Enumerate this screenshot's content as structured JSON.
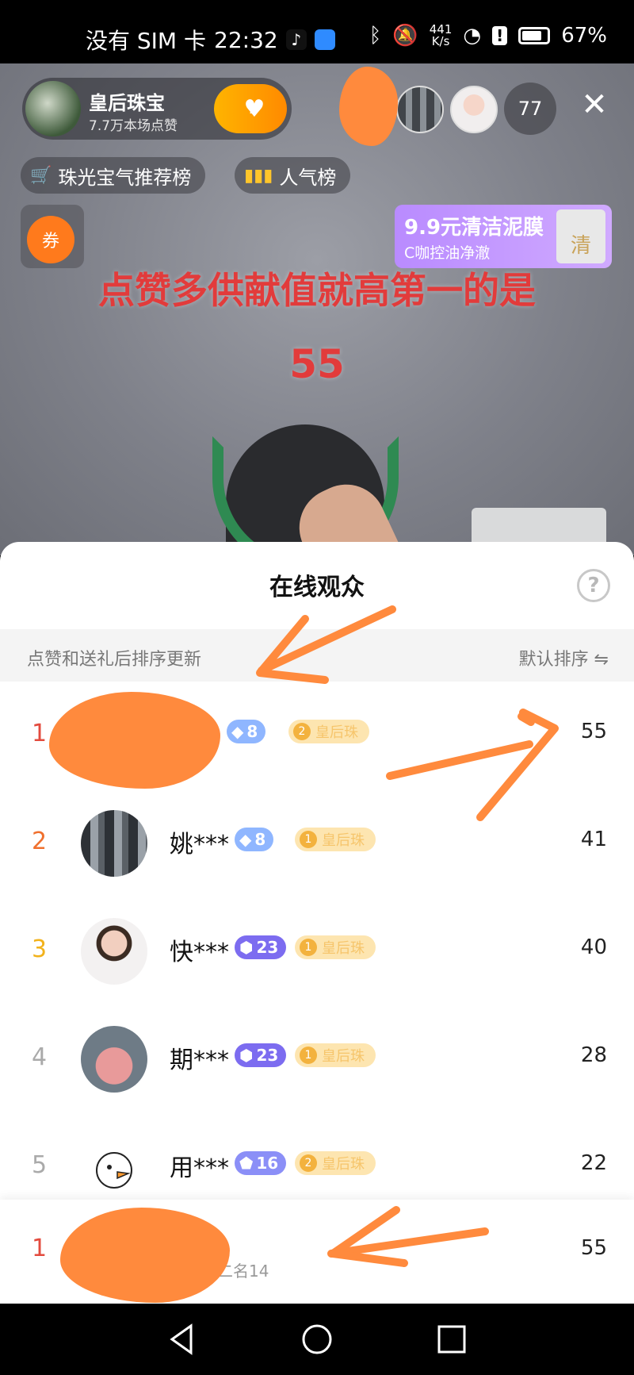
{
  "status_bar": {
    "carrier": "没有 SIM 卡",
    "time": "22:32",
    "net_speed_value": "441",
    "net_speed_unit": "K/s",
    "battery": "67%"
  },
  "live": {
    "anchor_name": "皇后珠宝",
    "anchor_likes": "7.7万本场点赞",
    "follow_level": "2",
    "viewer_count": "77",
    "rank_chip_1": "珠光宝气推荐榜",
    "rank_chip_2": "人气榜",
    "coupon_label": "券",
    "promo_title": "9.9元清洁泥膜",
    "promo_sub": "C咖控油净澈",
    "promo_box_label": "清",
    "overlay_line_1": "点赞多供献值就高第一的是",
    "overlay_line_2": "55"
  },
  "sheet": {
    "title": "在线观众",
    "help": "?",
    "sort_hint": "点赞和送礼后排序更新",
    "sort_label": "默认排序 ⇋",
    "rows": [
      {
        "rank": "1",
        "name": "",
        "level": "8",
        "club_num": "2",
        "club": "皇后珠",
        "score": "55"
      },
      {
        "rank": "2",
        "name": "姚***",
        "level": "8",
        "club_num": "1",
        "club": "皇后珠",
        "score": "41"
      },
      {
        "rank": "3",
        "name": "快***",
        "level": "23",
        "club_num": "1",
        "club": "皇后珠",
        "score": "40"
      },
      {
        "rank": "4",
        "name": "期***",
        "level": "23",
        "club_num": "1",
        "club": "皇后珠",
        "score": "28"
      },
      {
        "rank": "5",
        "name": "用***",
        "level": "16",
        "club_num": "2",
        "club": "皇后珠",
        "score": "22"
      }
    ],
    "my_rank": {
      "rank": "1",
      "lead_text": "领先第二名14",
      "score": "55"
    }
  },
  "colors": {
    "rank1": "#e34b3e",
    "rank2": "#f0702e",
    "rank3": "#f2b21b",
    "scribble": "#ff8a3d",
    "promo": "#c39bff"
  }
}
